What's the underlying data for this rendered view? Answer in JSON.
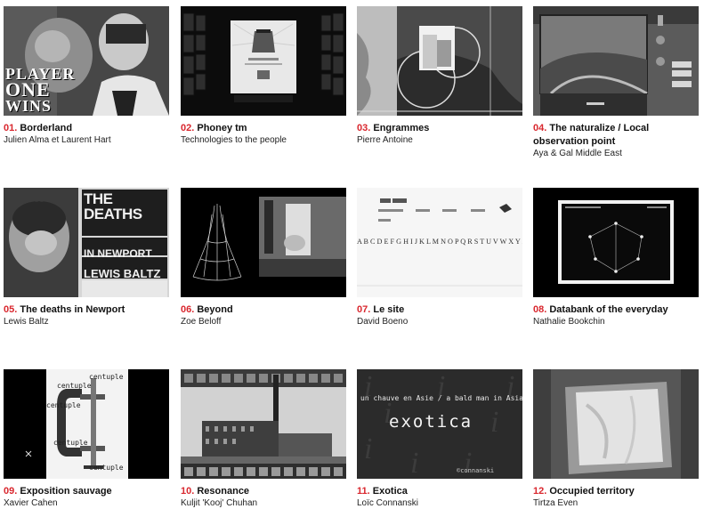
{
  "accent_color": "#d9272e",
  "projects": [
    {
      "number": "01.",
      "title": "Borderland",
      "author": "Julien Alma et Laurent Hart",
      "thumb_text": [
        "PLAYER",
        "ONE",
        "WINS"
      ]
    },
    {
      "number": "02.",
      "title": "Phoney tm",
      "author": "Technologies to the people"
    },
    {
      "number": "03.",
      "title": "Engrammes",
      "author": "Pierre Antoine"
    },
    {
      "number": "04.",
      "title": "The naturalize / Local observation point",
      "author": "Aya & Gal Middle East"
    },
    {
      "number": "05.",
      "title": "The deaths in Newport",
      "author": "Lewis Baltz",
      "thumb_text": [
        "THE DEATHS",
        "IN NEWPORT",
        "LEWIS BALTZ"
      ]
    },
    {
      "number": "06.",
      "title": "Beyond",
      "author": "Zoe Beloff"
    },
    {
      "number": "07.",
      "title": "Le site",
      "author": "David Boeno",
      "thumb_text": [
        "A B C D E F G H I J K L M N O P Q R S T U V W X Y Z"
      ]
    },
    {
      "number": "08.",
      "title": "Databank of the everyday",
      "author": "Nathalie Bookchin"
    },
    {
      "number": "09.",
      "title": "Exposition sauvage",
      "author": "Xavier Cahen",
      "thumb_text": [
        "centuple"
      ]
    },
    {
      "number": "10.",
      "title": "Resonance",
      "author": "Kuljit 'Kooj' Chuhan"
    },
    {
      "number": "11.",
      "title": "Exotica",
      "author": "Loïc Connanski",
      "thumb_text": [
        "un chauve en Asie / a bald man in Asia",
        "exotica",
        "©connanski"
      ]
    },
    {
      "number": "12.",
      "title": "Occupied territory",
      "author": "Tirtza Even"
    }
  ]
}
